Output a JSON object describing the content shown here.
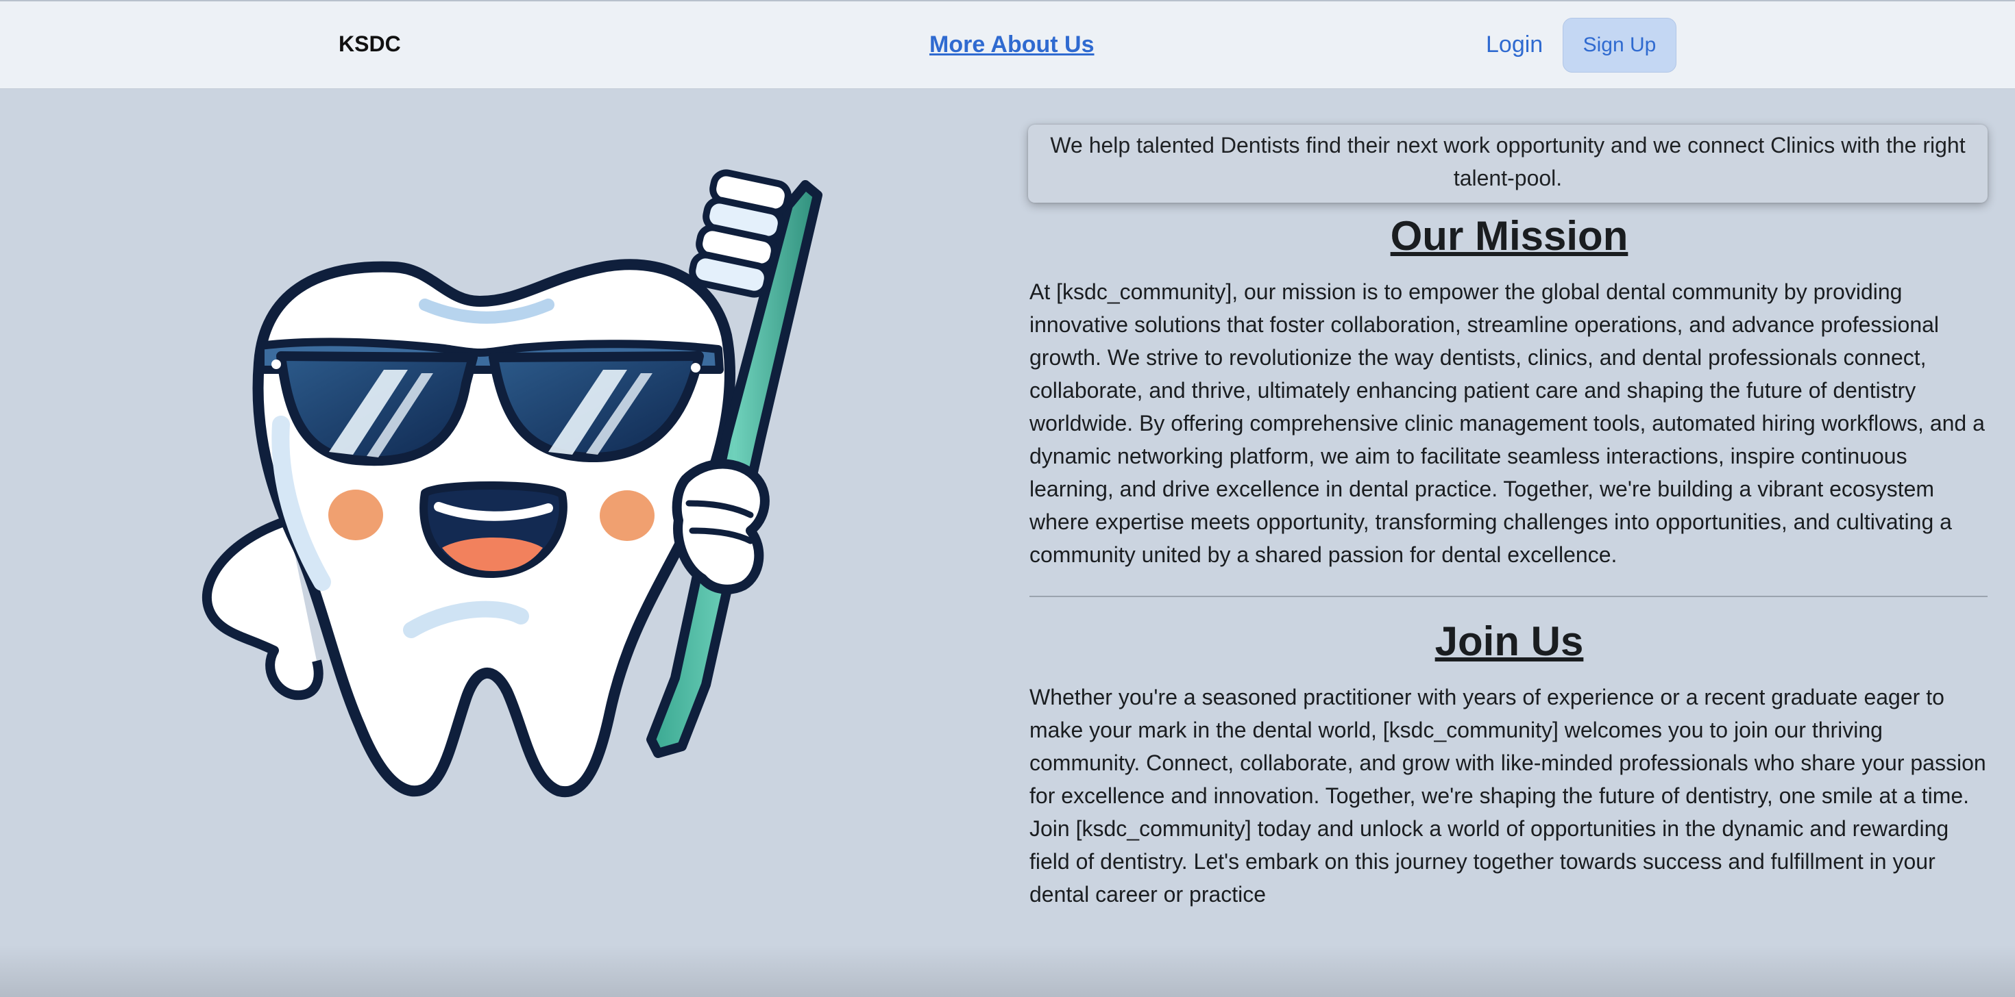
{
  "nav": {
    "brand": "KSDC",
    "about_link": "More About Us",
    "login_link": "Login",
    "signup_button": "Sign Up"
  },
  "hero": {
    "tagline": "We help talented Dentists find their next work opportunity and we connect Clinics with the right talent-pool."
  },
  "mission": {
    "title": "Our Mission",
    "body": "At [ksdc_community], our mission is to empower the global dental community by providing innovative solutions that foster collaboration, streamline operations, and advance professional growth. We strive to revolutionize the way dentists, clinics, and dental professionals connect, collaborate, and thrive, ultimately enhancing patient care and shaping the future of dentistry worldwide. By offering comprehensive clinic management tools, automated hiring workflows, and a dynamic networking platform, we aim to facilitate seamless interactions, inspire continuous learning, and drive excellence in dental practice. Together, we're building a vibrant ecosystem where expertise meets opportunity, transforming challenges into opportunities, and cultivating a community united by a shared passion for dental excellence."
  },
  "join": {
    "title": "Join Us",
    "body": "Whether you're a seasoned practitioner with years of experience or a recent graduate eager to make your mark in the dental world, [ksdc_community] welcomes you to join our thriving community. Connect, collaborate, and grow with like-minded professionals who share your passion for excellence and innovation. Together, we're shaping the future of dentistry, one smile at a time. Join [ksdc_community] today and unlock a world of opportunities in the dynamic and rewarding field of dentistry. Let's embark on this journey together towards success and fulfillment in your dental career or practice"
  },
  "illustration": {
    "icon": "tooth-mascot-with-sunglasses-and-toothbrush"
  },
  "colors": {
    "page_bg": "#cbd4e0",
    "navbar_bg": "#edf1f6",
    "link": "#2f6ad0",
    "button_bg": "#c4d7f3"
  }
}
